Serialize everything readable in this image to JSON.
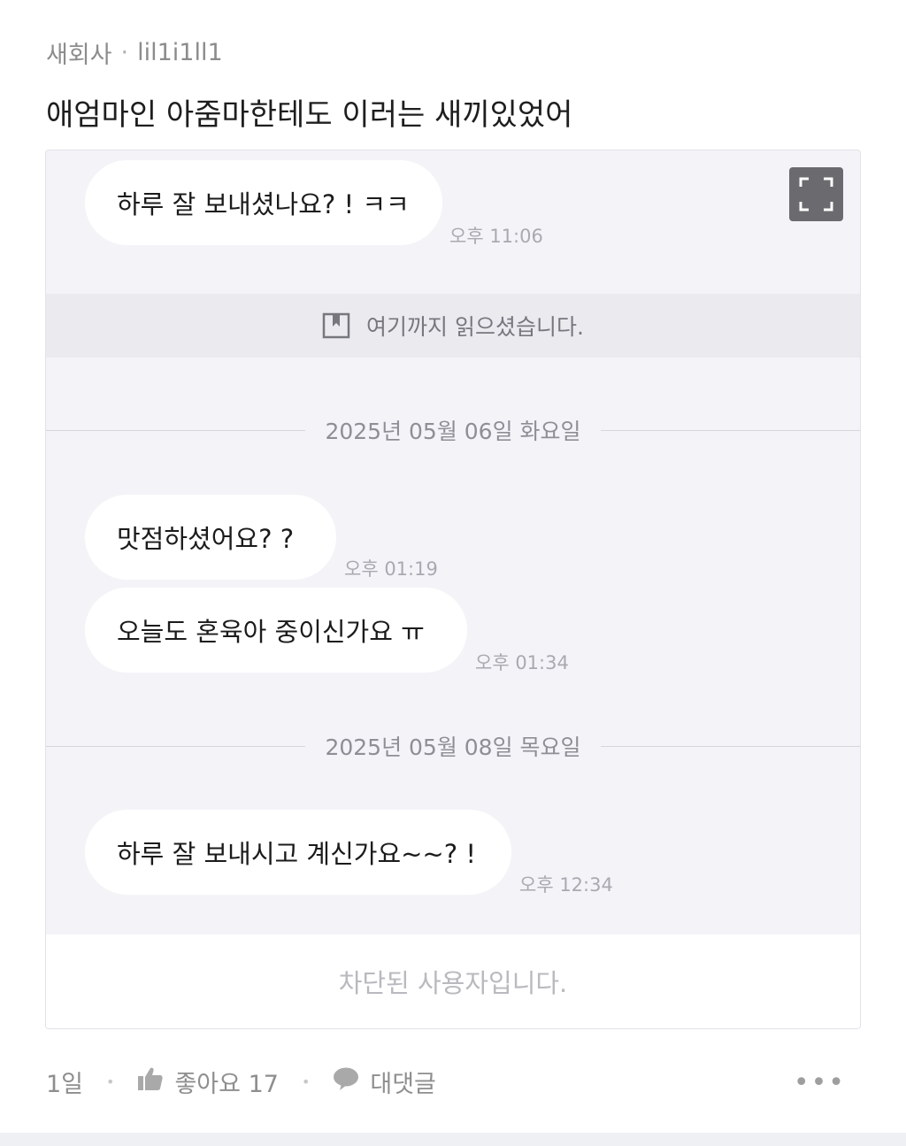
{
  "post": {
    "company": "새회사",
    "separator": "·",
    "author": "lil1i1ll1",
    "title": "애엄마인 아줌마한테도 이러는 새끼있었어"
  },
  "chat": {
    "messages": [
      {
        "text": "하루 잘 보내셨나요? ! ㅋㅋ",
        "time": "오후 11:06"
      },
      {
        "text": "맛점하셨어요? ?",
        "time": "오후 01:19"
      },
      {
        "text": "오늘도 혼육아 중이신가요 ㅠ",
        "time": "오후 01:34"
      },
      {
        "text": "하루 잘 보내시고 계신가요~~? !",
        "time": "오후 12:34"
      }
    ],
    "read_marker": "여기까지 읽으셨습니다.",
    "dates": [
      "2025년 05월 06일 화요일",
      "2025년 05월 08일 목요일"
    ],
    "blocked_notice": "차단된 사용자입니다.",
    "expand_icon": "fullscreen-icon",
    "bookmark_icon": "bookmark-icon"
  },
  "footer": {
    "age": "1일",
    "like_label": "좋아요 17",
    "reply_label": "대댓글",
    "more": "•••",
    "like_icon": "thumbs-up-icon",
    "reply_icon": "speech-bubble-icon"
  }
}
